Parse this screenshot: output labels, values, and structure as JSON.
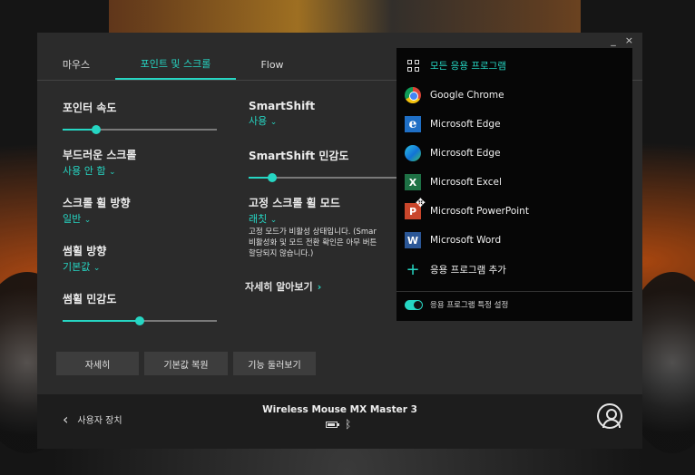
{
  "window": {
    "minimize": "_",
    "close": "×"
  },
  "tabs": [
    {
      "label": "마우스"
    },
    {
      "label": "포인트 및 스크롤"
    },
    {
      "label": "Flow"
    }
  ],
  "left": {
    "pointer_speed_label": "포인터 속도",
    "pointer_speed_value": 0.22,
    "smooth_scroll_label": "부드러운 스크롤",
    "smooth_scroll_value": "사용 안 함",
    "scroll_direction_label": "스크롤 휠 방향",
    "scroll_direction_value": "일반",
    "thumbwheel_direction_label": "썸휠 방향",
    "thumbwheel_direction_value": "기본값",
    "thumbwheel_sensitivity_label": "썸휠 민감도",
    "thumbwheel_sensitivity_value": 0.5
  },
  "mid": {
    "smartshift_label": "SmartShift",
    "smartshift_value": "사용",
    "smartshift_sens_label": "SmartShift 민감도",
    "smartshift_sens_value": 0.13,
    "fixed_mode_label": "고정 스크롤 휠 모드",
    "fixed_mode_value": "래칫",
    "note_line1": "고정 모드가 비활성 상태입니다. (Smar",
    "note_line2": "비활성화 및 모드 전환 확인은 아무 버튼",
    "note_line3": "할당되지 않습니다.)",
    "more_link": "자세히 알아보기"
  },
  "buttons": {
    "details": "자세히",
    "restore": "기본값 복원",
    "tour": "기능 둘러보기"
  },
  "footer": {
    "back_label": "사용자 장치",
    "device_name": "Wireless Mouse MX Master 3"
  },
  "dropdown": {
    "all_apps": "모든 응용 프로그램",
    "apps": [
      {
        "name": "Google Chrome",
        "icon": "chrome-icon"
      },
      {
        "name": "Microsoft Edge",
        "icon": "edge-legacy-icon"
      },
      {
        "name": "Microsoft Edge",
        "icon": "edge-icon"
      },
      {
        "name": "Microsoft Excel",
        "icon": "excel-icon"
      },
      {
        "name": "Microsoft PowerPoint",
        "icon": "powerpoint-icon"
      },
      {
        "name": "Microsoft Word",
        "icon": "word-icon"
      }
    ],
    "add_app": "응용 프로그램 추가",
    "app_specific": "응용 프로그램 특정 설정",
    "app_specific_enabled": true
  },
  "colors": {
    "accent": "#26d6c3",
    "panel": "#2b2b2b",
    "dropdown": "#060606"
  }
}
